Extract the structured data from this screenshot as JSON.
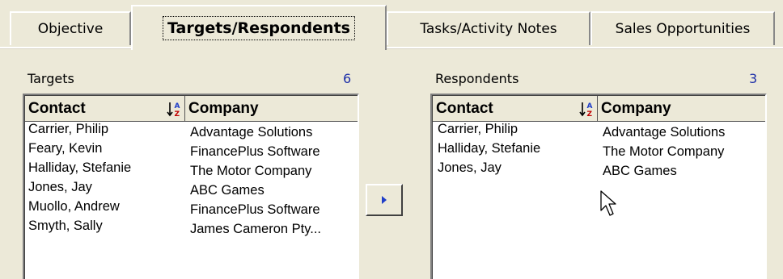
{
  "tabs": [
    {
      "label": "Objective"
    },
    {
      "label": "Targets/Respondents",
      "active": true
    },
    {
      "label": "Tasks/Activity Notes"
    },
    {
      "label": "Sales Opportunities"
    }
  ],
  "targets": {
    "title": "Targets",
    "count": "6",
    "columns": [
      "Contact",
      "Company"
    ],
    "rows": [
      {
        "contact": "Carrier, Philip",
        "company": "Advantage Solutions"
      },
      {
        "contact": "Feary, Kevin",
        "company": "FinancePlus Software"
      },
      {
        "contact": "Halliday, Stefanie",
        "company": "The Motor Company"
      },
      {
        "contact": "Jones, Jay",
        "company": "ABC Games"
      },
      {
        "contact": "Muollo, Andrew",
        "company": "FinancePlus Software"
      },
      {
        "contact": "Smyth, Sally",
        "company": "James Cameron Pty..."
      }
    ]
  },
  "respondents": {
    "title": "Respondents",
    "count": "3",
    "columns": [
      "Contact",
      "Company"
    ],
    "rows": [
      {
        "contact": "Carrier, Philip",
        "company": "Advantage Solutions"
      },
      {
        "contact": "Halliday, Stefanie",
        "company": "The Motor Company"
      },
      {
        "contact": "Jones, Jay",
        "company": "ABC Games"
      }
    ]
  },
  "icons": {
    "sort": "sort-az-icon",
    "move": "arrow-right-icon",
    "cursor": "mouse-pointer-icon"
  },
  "colors": {
    "count": "#1c2ea8",
    "arrow": "#1f3ec8",
    "background": "#ece9d8"
  }
}
